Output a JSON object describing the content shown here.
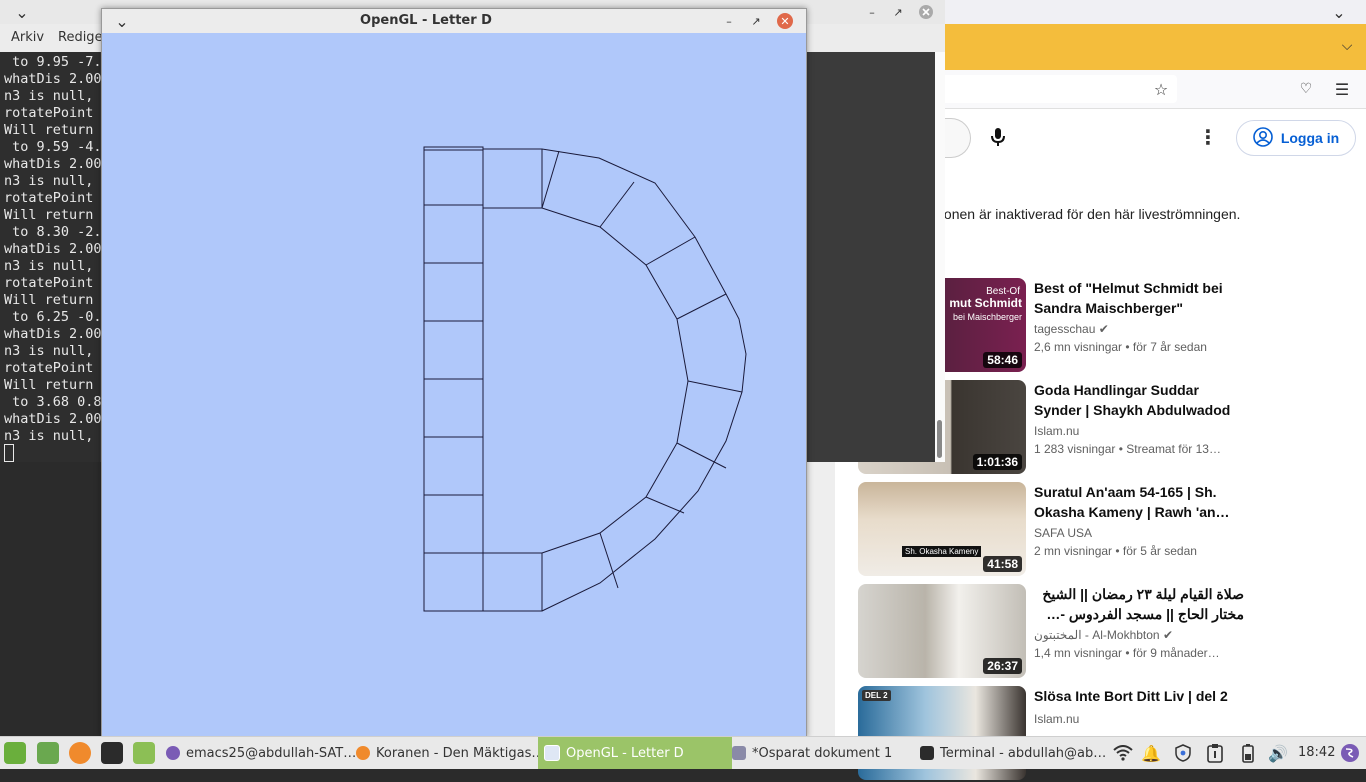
{
  "terminal": {
    "menu": [
      "Arkiv",
      "Redige"
    ],
    "lines": [
      " to 9.95 -7.",
      "whatDis 2.00",
      "n3 is null,",
      "rotatePoint",
      "Will return",
      " to 9.59 -4.",
      "whatDis 2.00",
      "n3 is null,",
      "rotatePoint",
      "Will return",
      " to 8.30 -2.",
      "whatDis 2.00",
      "n3 is null,",
      "rotatePoint",
      "Will return",
      " to 6.25 -0.",
      "whatDis 2.00",
      "n3 is null,",
      "rotatePoint",
      "Will return",
      " to 3.68 0.8",
      "whatDis 2.00",
      "n3 is null,"
    ]
  },
  "opengl": {
    "title": "OpenGL - Letter D",
    "bg_color": "#b0c8fa"
  },
  "browser": {
    "login_label": "Logga in",
    "chat_notice": "Chattfunktionen är inaktiverad för den här liveströmningen.",
    "videos": [
      {
        "title": "Best of \"Helmut Schmidt bei Sandra Maischberger\"",
        "channel": "tagesschau",
        "verified": true,
        "meta": "2,6 mn visningar  • för 7 år sedan",
        "duration": "58:46",
        "thumb_text": "mut Schmidt",
        "thumb_sub": "bei Maischberger",
        "thumb_tag": "Best-Of"
      },
      {
        "title": "Goda Handlingar Suddar Synder | Shaykh Abdulwadod",
        "channel": "Islam.nu",
        "verified": false,
        "meta": "1 283 visningar  • Streamat för 13…",
        "duration": "1:01:36"
      },
      {
        "title": "Suratul An'aam 54-165 | Sh. Okasha Kameny | Rawh 'an…",
        "channel": "SAFA USA",
        "verified": false,
        "meta": "2 mn visningar  • för 5 år sedan",
        "duration": "41:58",
        "thumb_sub": "Sh. Okasha Kameny"
      },
      {
        "title": "صلاة القيام ليلة ٢٣ رمضان || الشيخ مختار الحاج || مسجد الفردوس -…",
        "channel": "المختبتون - Al-Mokhbton",
        "verified": true,
        "meta": "1,4 mn visningar  • för 9 månader…",
        "duration": "26:37"
      },
      {
        "title": "Slösa Inte Bort Ditt Liv | del 2",
        "channel": "Islam.nu",
        "verified": false,
        "meta": "",
        "duration": "",
        "thumb_tag": "DEL 2"
      }
    ]
  },
  "taskbar": {
    "tasks": [
      {
        "label": "emacs25@abdullah-SAT…",
        "active": false
      },
      {
        "label": "Koranen - Den Mäktigas…",
        "active": false
      },
      {
        "label": "OpenGL - Letter D",
        "active": true
      },
      {
        "label": "*Osparat dokument 1",
        "active": false
      },
      {
        "label": "Terminal - abdullah@ab…",
        "active": false
      }
    ],
    "clock": "18:42"
  }
}
